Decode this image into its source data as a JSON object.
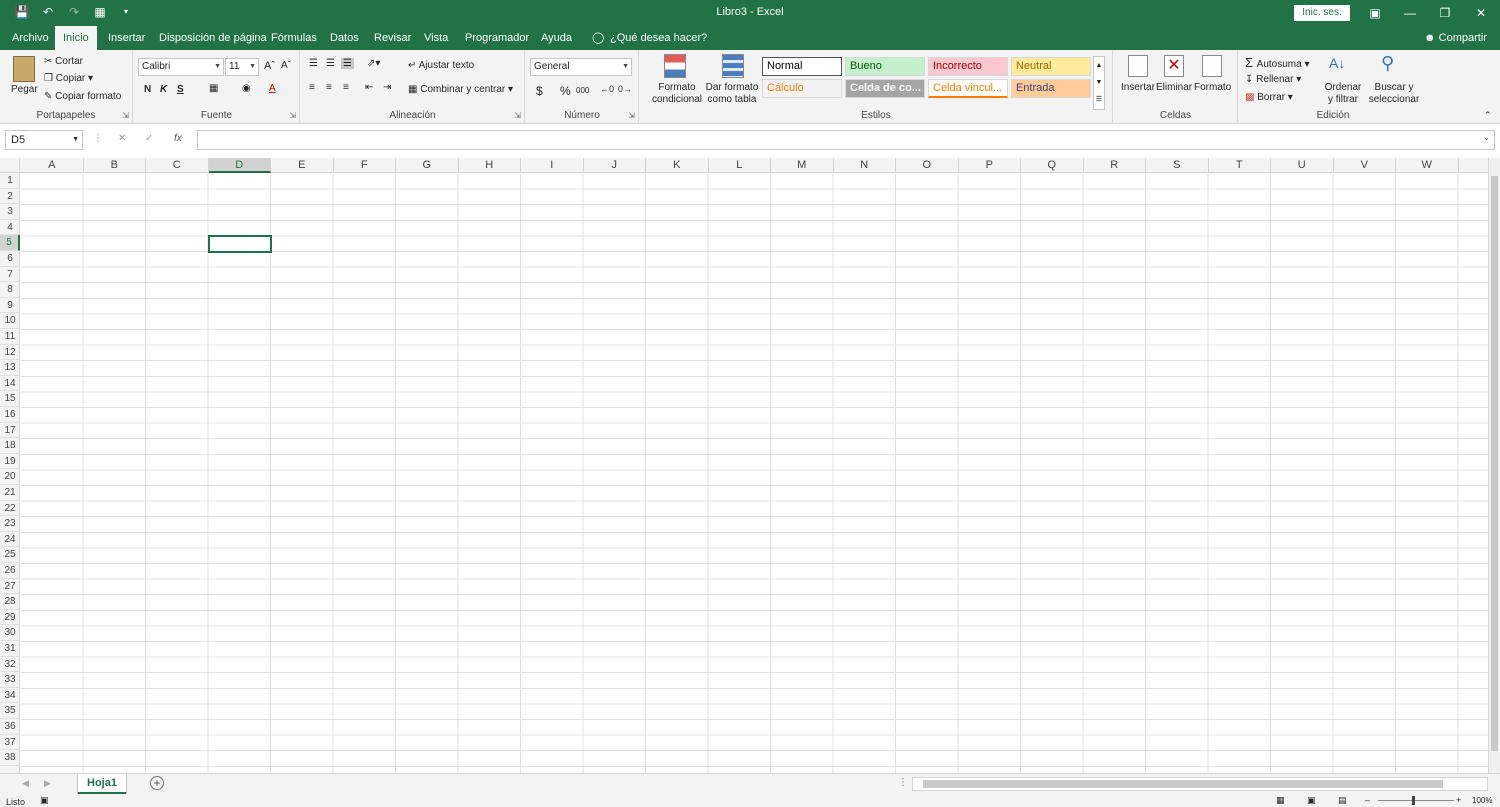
{
  "window": {
    "title": "Libro3 - Excel",
    "signin_label": "Inic. ses.",
    "share_label": "Compartir"
  },
  "tabs": [
    "Archivo",
    "Inicio",
    "Insertar",
    "Disposición de página",
    "Fórmulas",
    "Datos",
    "Revisar",
    "Vista",
    "Programador",
    "Ayuda"
  ],
  "tell_me": "¿Qué desea hacer?",
  "clipboard": {
    "paste": "Pegar",
    "cut": "Cortar",
    "copy": "Copiar",
    "format_painter": "Copiar formato",
    "label": "Portapapeles"
  },
  "font": {
    "name": "Calibri",
    "size": "11",
    "bold": "N",
    "italic": "K",
    "underline": "S",
    "label": "Fuente"
  },
  "alignment": {
    "wrap": "Ajustar texto",
    "merge": "Combinar y centrar",
    "label": "Alineación"
  },
  "number": {
    "format": "General",
    "currency": "$",
    "percent": "%",
    "thousands": "000",
    "label": "Número"
  },
  "styles": {
    "conditional": "Formato condicional",
    "as_table": "Dar formato como tabla",
    "items": [
      {
        "name": "Normal",
        "bg": "#ffffff",
        "fg": "#000000"
      },
      {
        "name": "Bueno",
        "bg": "#c6efce",
        "fg": "#006100"
      },
      {
        "name": "Incorrecto",
        "bg": "#ffc7ce",
        "fg": "#9c0006"
      },
      {
        "name": "Neutral",
        "bg": "#ffeb9c",
        "fg": "#9c6500"
      },
      {
        "name": "Cálculo",
        "bg": "#f2f2f2",
        "fg": "#fa7d00"
      },
      {
        "name": "Celda de co...",
        "bg": "#a5a5a5",
        "fg": "#ffffff"
      },
      {
        "name": "Celda vincul...",
        "bg": "#ffffff",
        "fg": "#fa7d00"
      },
      {
        "name": "Entrada",
        "bg": "#ffcc99",
        "fg": "#3f3f76"
      }
    ],
    "label": "Estilos"
  },
  "cells_group": {
    "insert": "Insertar",
    "delete": "Eliminar",
    "format": "Formato",
    "label": "Celdas"
  },
  "editing": {
    "autosum": "Autosuma",
    "fill": "Rellenar",
    "clear": "Borrar",
    "sort": "Ordenar y filtrar",
    "find": "Buscar y seleccionar",
    "label": "Edición"
  },
  "formula_bar": {
    "name_box": "D5",
    "fx": "fx",
    "value": ""
  },
  "columns": [
    "A",
    "B",
    "C",
    "D",
    "E",
    "F",
    "G",
    "H",
    "I",
    "J",
    "K",
    "L",
    "M",
    "N",
    "O",
    "P",
    "Q",
    "R",
    "S",
    "T",
    "U",
    "V",
    "W"
  ],
  "row_count": 38,
  "active_cell": {
    "column": "D",
    "row": 5
  },
  "sheet_tab": "Hoja1",
  "status": {
    "text": "Listo",
    "zoom": "100%"
  },
  "accent": "#217346"
}
